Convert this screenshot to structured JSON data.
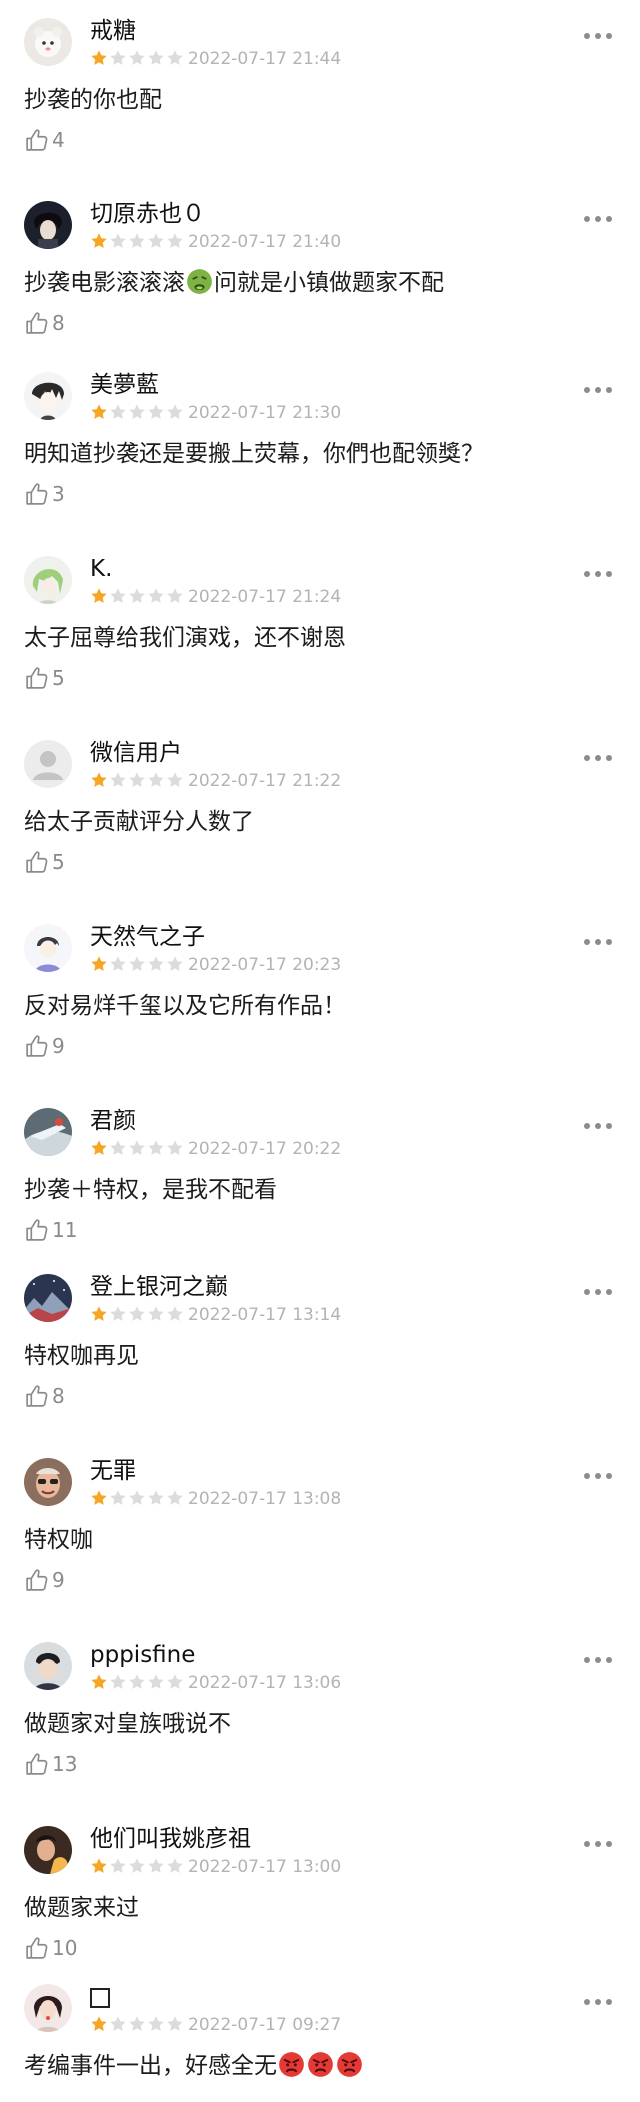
{
  "comments": [
    {
      "username": "戒糖",
      "time": "2022-07-17 21:44",
      "text": "抄袭的你也配",
      "likes": "4",
      "rating_stars": 1
    },
    {
      "username": "切原赤也０",
      "time": "2022-07-17 21:40",
      "text_before": "抄袭电影滚滚滚",
      "text_after": "问就是小镇做题家不配",
      "emoji": "nauseated-face",
      "likes": "8",
      "rating_stars": 1
    },
    {
      "username": "美夢藍",
      "time": "2022-07-17 21:30",
      "text": "明知道抄袭还是要搬上荧幕，你們也配领獎？",
      "likes": "3",
      "rating_stars": 1
    },
    {
      "username": "K.",
      "time": "2022-07-17 21:24",
      "text": "太子屈尊给我们演戏，还不谢恩",
      "likes": "5",
      "rating_stars": 1
    },
    {
      "username": "微信用户",
      "time": "2022-07-17 21:22",
      "text": "给太子贡献评分人数了",
      "likes": "5",
      "rating_stars": 1
    },
    {
      "username": "天然气之子",
      "time": "2022-07-17 20:23",
      "text": "反对易烊千玺以及它所有作品！",
      "likes": "9",
      "rating_stars": 1
    },
    {
      "username": "君颜",
      "time": "2022-07-17 20:22",
      "text": "抄袭＋特权，是我不配看",
      "likes": "11",
      "rating_stars": 1
    },
    {
      "username": "登上银河之巅",
      "time": "2022-07-17 13:14",
      "text": "特权咖再见",
      "likes": "8",
      "rating_stars": 1
    },
    {
      "username": "无罪",
      "time": "2022-07-17 13:08",
      "text": "特权咖",
      "likes": "9",
      "rating_stars": 1
    },
    {
      "username": "pppisfine",
      "time": "2022-07-17 13:06",
      "text": "做题家对皇族哦说不",
      "likes": "13",
      "rating_stars": 1
    },
    {
      "username": "他们叫我姚彦祖",
      "time": "2022-07-17 13:00",
      "text": "做题家来过",
      "likes": "10",
      "rating_stars": 1
    },
    {
      "username": "",
      "time": "2022-07-17 09:27",
      "text": "考编事件一出，好感全无",
      "emojis": [
        "angry-face",
        "angry-face",
        "angry-face"
      ],
      "rating_stars": 1
    }
  ],
  "colors": {
    "star_filled": "#f5a623",
    "star_empty": "#dcdcdc",
    "time": "#b3b3b3",
    "likes": "#8a8a8a",
    "text": "#1c1c1c"
  },
  "icons": {
    "more": "more-dots-icon",
    "like": "thumbs-up-icon",
    "star": "star-icon"
  }
}
